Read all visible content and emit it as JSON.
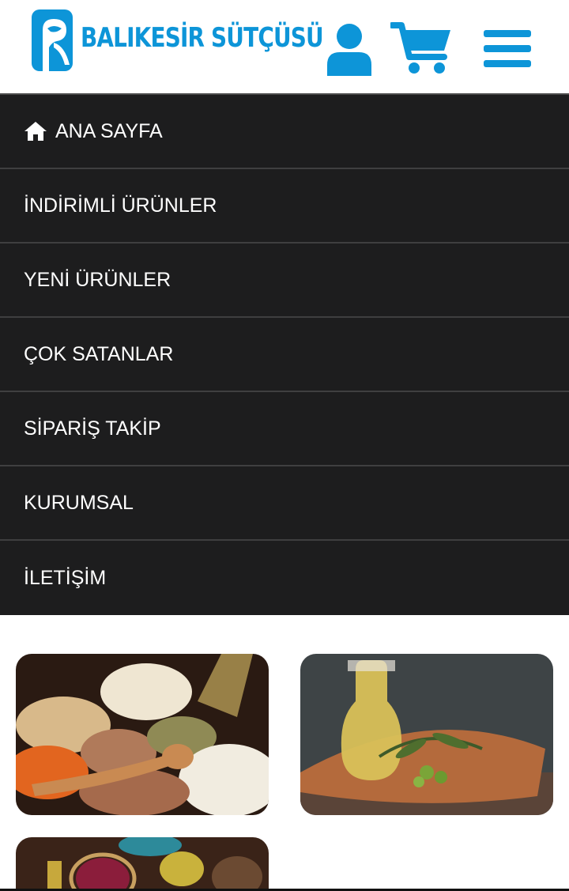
{
  "header": {
    "logo_text": "BALIKESİR SÜTÇÜSÜ",
    "icons": [
      "user-icon",
      "cart-icon",
      "hamburger-menu-icon"
    ],
    "accent_color": "#0d95d8"
  },
  "nav": {
    "background": "#1d1d1e",
    "items": [
      {
        "label": "ANA SAYFA",
        "icon": "home-icon"
      },
      {
        "label": "İNDİRİMLİ ÜRÜNLER"
      },
      {
        "label": "YENİ ÜRÜNLER"
      },
      {
        "label": "ÇOK SATANLAR"
      },
      {
        "label": "SİPARİŞ TAKİP"
      },
      {
        "label": "KURUMSAL"
      },
      {
        "label": "İLETİŞİM"
      }
    ]
  },
  "categories": [
    {
      "image": "legumes-grains-photo"
    },
    {
      "image": "olive-oil-photo"
    },
    {
      "image": "breakfast-spread-photo"
    }
  ]
}
